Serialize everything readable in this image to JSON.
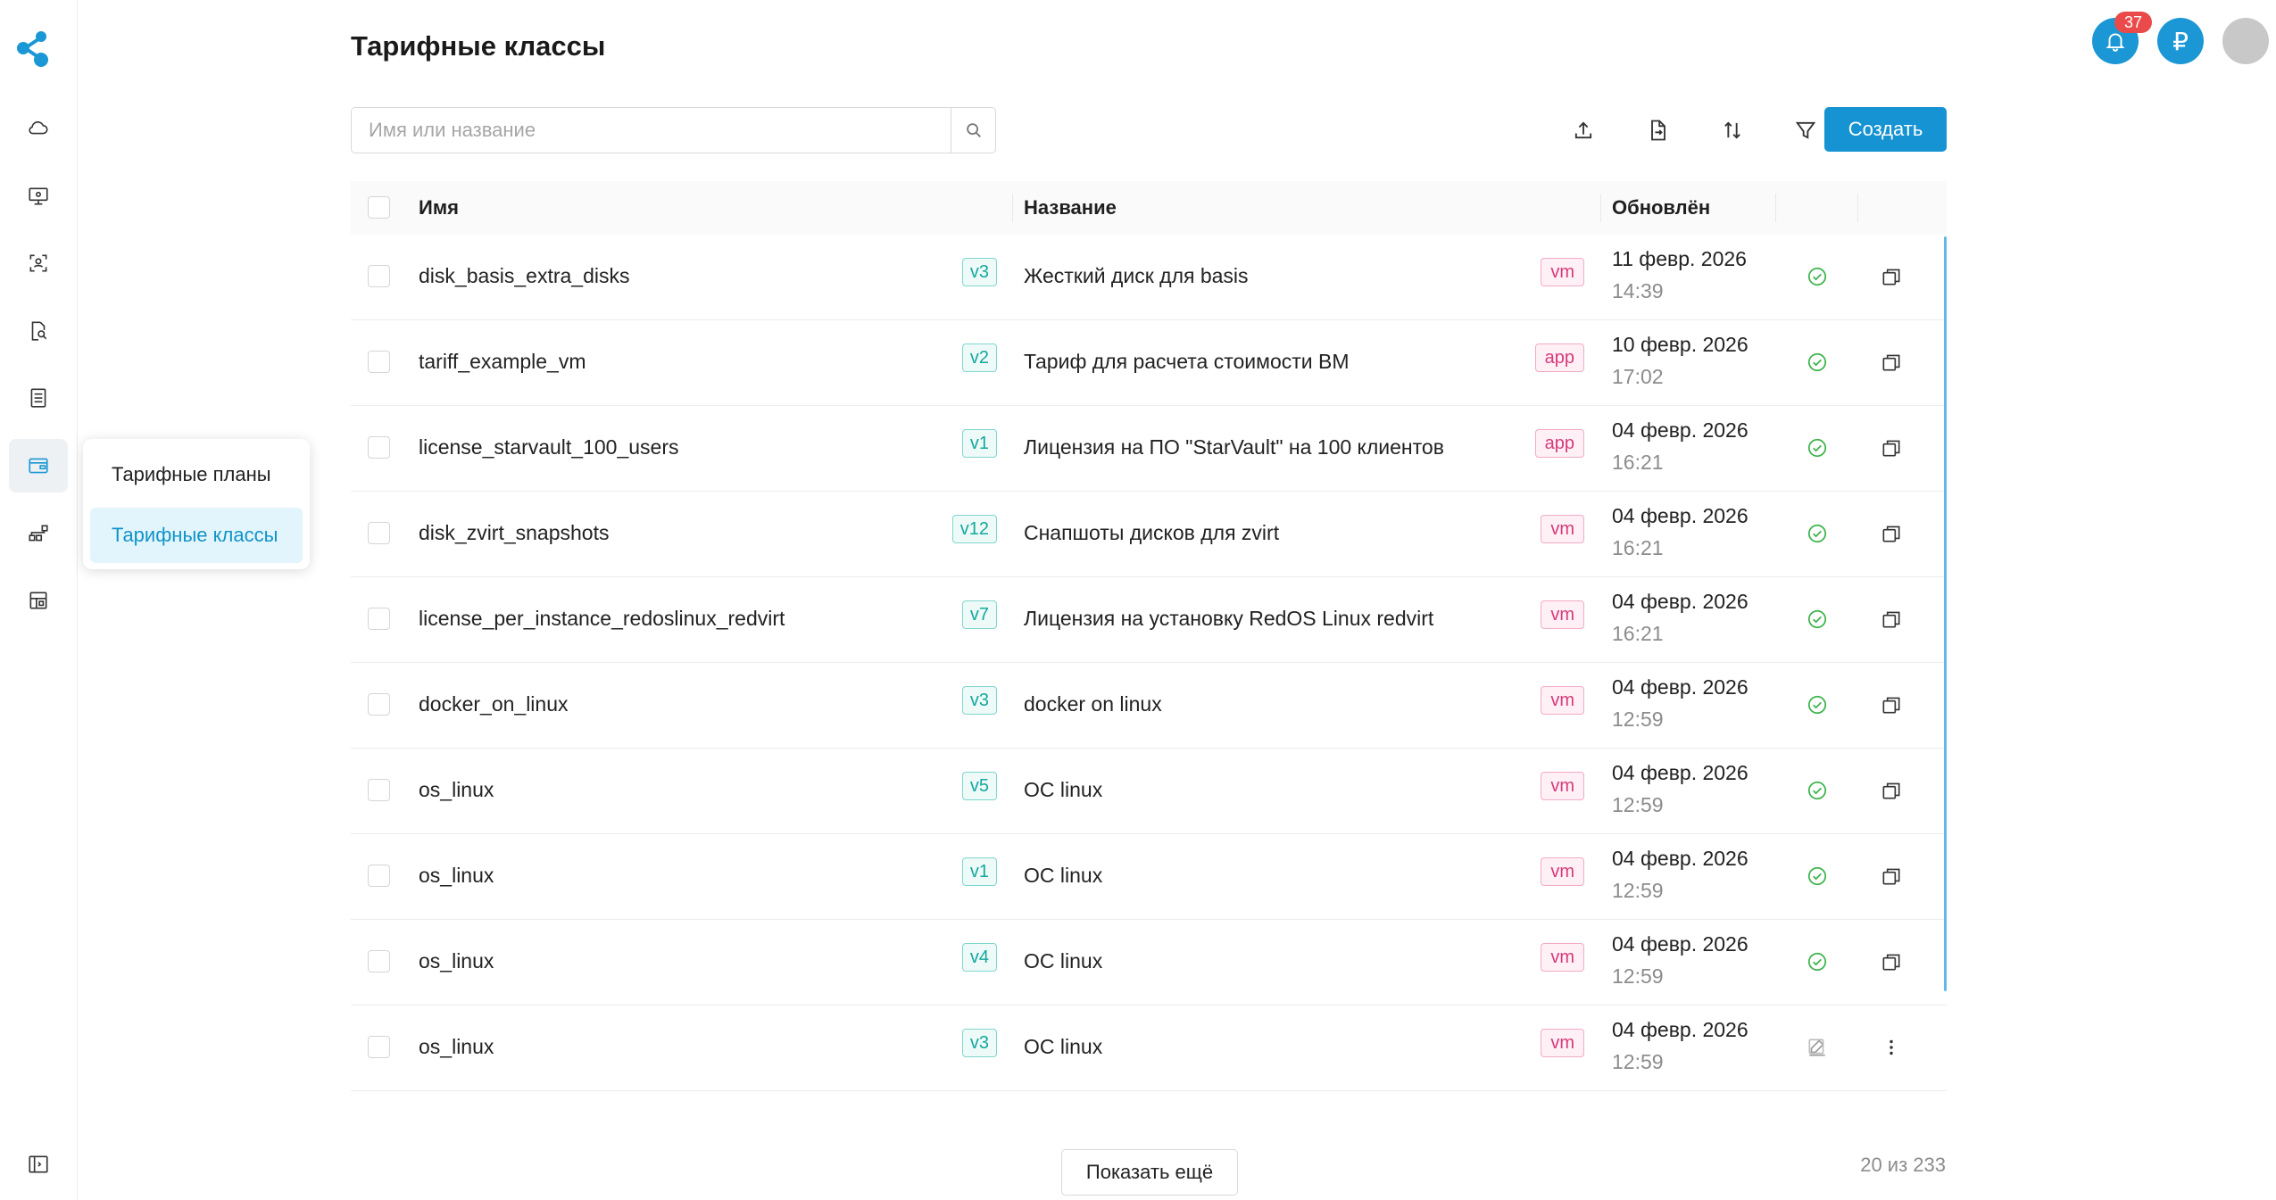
{
  "header": {
    "title": "Тарифные классы",
    "notification_count": "37",
    "currency_symbol": "₽"
  },
  "sidebar": {
    "items": [
      {
        "icon": "cloud-icon"
      },
      {
        "icon": "monitor-settings-icon"
      },
      {
        "icon": "scan-user-icon"
      },
      {
        "icon": "search-document-icon"
      },
      {
        "icon": "list-document-icon"
      },
      {
        "icon": "wallet-icon",
        "active": true
      },
      {
        "icon": "hierarchy-icon"
      },
      {
        "icon": "apps-icon"
      }
    ],
    "footer_icon": "expand-sidebar-icon"
  },
  "flyout": {
    "items": [
      {
        "label": "Тарифные планы"
      },
      {
        "label": "Тарифные классы",
        "active": true
      }
    ]
  },
  "search": {
    "placeholder": "Имя или название",
    "value": ""
  },
  "toolbar": {
    "icons": [
      "upload-icon",
      "export-file-icon",
      "sort-icon",
      "filter-icon"
    ],
    "create_label": "Создать"
  },
  "table": {
    "columns": {
      "name": "Имя",
      "title": "Название",
      "updated": "Обновлён"
    },
    "rows": [
      {
        "name": "disk_basis_extra_disks",
        "version": "v3",
        "title": "Жесткий диск для basis",
        "type": "vm",
        "date": "11 февр. 2026",
        "time": "14:39",
        "status": "check",
        "action": "copy"
      },
      {
        "name": "tariff_example_vm",
        "version": "v2",
        "title": "Тариф для расчета стоимости ВМ",
        "type": "app",
        "date": "10 февр. 2026",
        "time": "17:02",
        "status": "check",
        "action": "copy"
      },
      {
        "name": "license_starvault_100_users",
        "version": "v1",
        "title": "Лицензия на ПО \"StarVault\" на 100 клиентов",
        "type": "app",
        "date": "04 февр. 2026",
        "time": "16:21",
        "status": "check",
        "action": "copy"
      },
      {
        "name": "disk_zvirt_snapshots",
        "version": "v12",
        "title": "Снапшоты дисков для zvirt",
        "type": "vm",
        "date": "04 февр. 2026",
        "time": "16:21",
        "status": "check",
        "action": "copy"
      },
      {
        "name": "license_per_instance_redoslinux_redvirt",
        "version": "v7",
        "title": "Лицензия на установку RedOS Linux redvirt",
        "type": "vm",
        "date": "04 февр. 2026",
        "time": "16:21",
        "status": "check",
        "action": "copy"
      },
      {
        "name": "docker_on_linux",
        "version": "v3",
        "title": "docker on linux",
        "type": "vm",
        "date": "04 февр. 2026",
        "time": "12:59",
        "status": "check",
        "action": "copy"
      },
      {
        "name": "os_linux",
        "version": "v5",
        "title": "ОС linux",
        "type": "vm",
        "date": "04 февр. 2026",
        "time": "12:59",
        "status": "check",
        "action": "copy"
      },
      {
        "name": "os_linux",
        "version": "v1",
        "title": "ОС linux",
        "type": "vm",
        "date": "04 февр. 2026",
        "time": "12:59",
        "status": "check",
        "action": "copy"
      },
      {
        "name": "os_linux",
        "version": "v4",
        "title": "ОС linux",
        "type": "vm",
        "date": "04 февр. 2026",
        "time": "12:59",
        "status": "check",
        "action": "copy"
      },
      {
        "name": "os_linux",
        "version": "v3",
        "title": "ОС linux",
        "type": "vm",
        "date": "04 февр. 2026",
        "time": "12:59",
        "status": "edit",
        "action": "more"
      }
    ]
  },
  "footer": {
    "show_more_label": "Показать ещё",
    "counter": "20 из 233"
  },
  "colors": {
    "accent": "#1693d2",
    "success": "#3cb34a",
    "version_tag": "#13a89e",
    "type_tag": "#d63a7b"
  }
}
